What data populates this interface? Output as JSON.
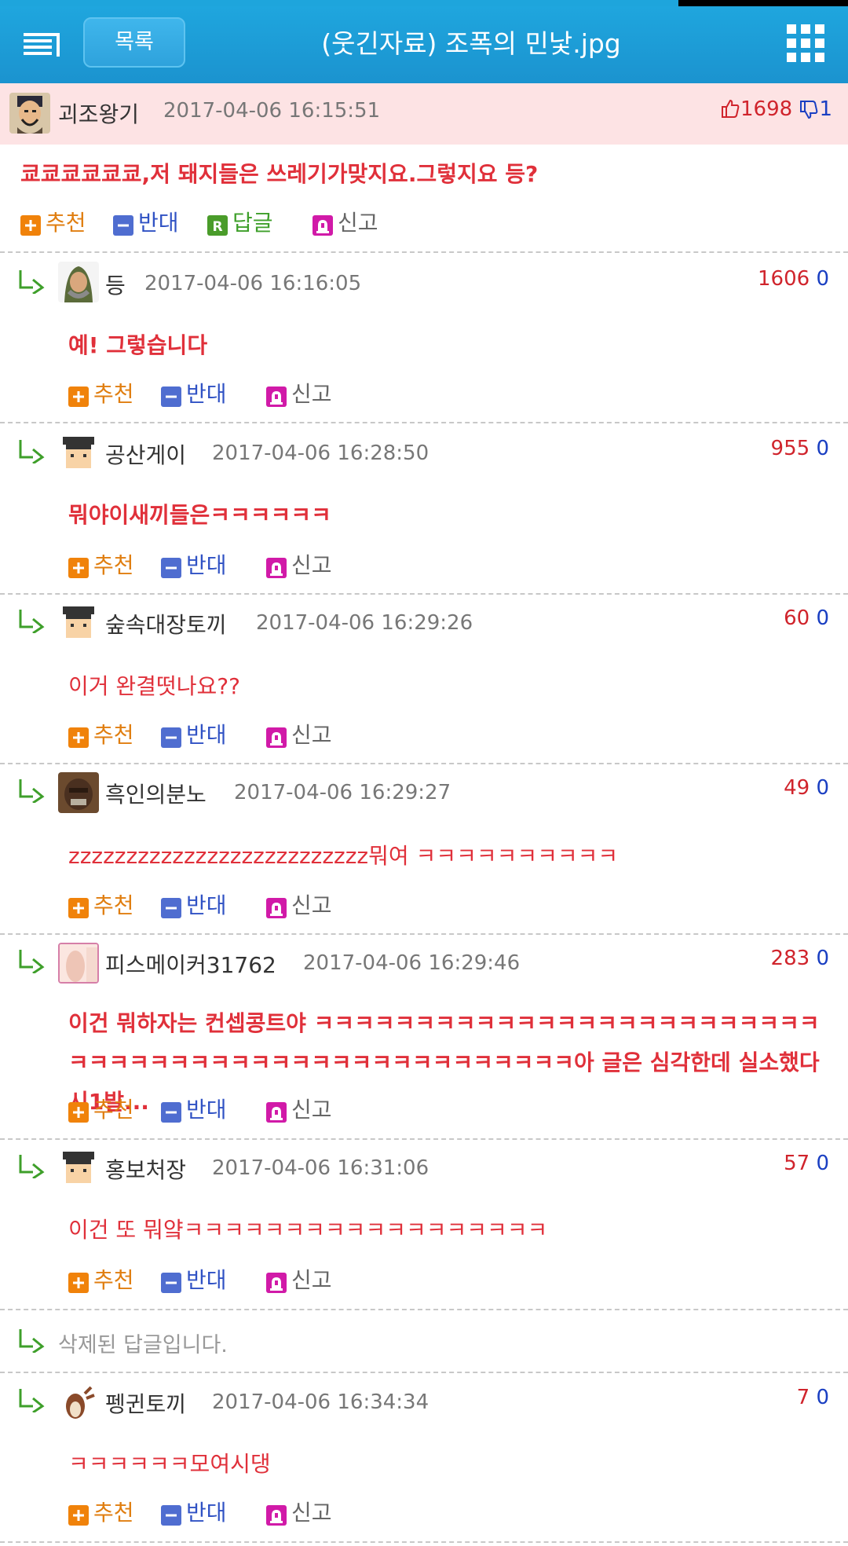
{
  "header": {
    "list_label": "목록",
    "title": "(웃긴자료) 조폭의 민낯.jpg"
  },
  "post": {
    "author": "괴조왕기",
    "date": "2017-04-06 16:15:51",
    "up": "1698",
    "down": "1",
    "text": "쿄쿄쿄쿄쿄쿄,저 돼지들은 쓰레기가맞지요.그렇지요 등?",
    "actions": {
      "recommend": "추천",
      "oppose": "반대",
      "reply": "답글",
      "report": "신고"
    }
  },
  "comments": [
    {
      "author": "등",
      "date": "2017-04-06 16:16:05",
      "up": "1606",
      "down": "0",
      "text": "예! 그렇습니다"
    },
    {
      "author": "공산게이",
      "date": "2017-04-06 16:28:50",
      "up": "955",
      "down": "0",
      "text": "뭐야이새끼들은ㅋㅋㅋㅋㅋㅋ"
    },
    {
      "author": "숲속대장토끼",
      "date": "2017-04-06 16:29:26",
      "up": "60",
      "down": "0",
      "text": "이거 완결떳나요??"
    },
    {
      "author": "흑인의분노",
      "date": "2017-04-06 16:29:27",
      "up": "49",
      "down": "0",
      "text": "zzzzzzzzzzzzzzzzzzzzzzzzzz뭐여 ㅋㅋㅋㅋㅋㅋㅋㅋㅋㅋ"
    },
    {
      "author": "피스메이커31762",
      "date": "2017-04-06 16:29:46",
      "up": "283",
      "down": "0",
      "text": "이건 뭐하자는 컨셉콩트야 ㅋㅋㅋㅋㅋㅋㅋㅋㅋㅋㅋㅋㅋㅋㅋㅋㅋㅋㅋㅋㅋㅋㅋㅋㅋㅋㅋㅋㅋㅋㅋㅋㅋㅋㅋㅋㅋㅋㅋㅋㅋㅋㅋㅋㅋㅋㅋㅋㅋㅋ아 글은 심각한데 실소했다 시1발..."
    },
    {
      "author": "홍보처장",
      "date": "2017-04-06 16:31:06",
      "up": "57",
      "down": "0",
      "text": "이건 또 뭐얔ㅋㅋㅋㅋㅋㅋㅋㅋㅋㅋㅋㅋㅋㅋㅋㅋㅋㅋ"
    },
    {
      "deleted_text": "삭제된 답글입니다."
    },
    {
      "author": "펭귄토끼",
      "date": "2017-04-06 16:34:34",
      "up": "7",
      "down": "0",
      "text": "ㅋㅋㅋㅋㅋㅋ모여시댕"
    }
  ],
  "comment_actions": {
    "recommend": "추천",
    "oppose": "반대",
    "report": "신고"
  },
  "colors": {
    "header": "#1fa6de",
    "post_bg": "#fde3e4",
    "comment_text": "#e0303a",
    "up_count": "#d0242c",
    "down_count": "#1a3fc2"
  }
}
